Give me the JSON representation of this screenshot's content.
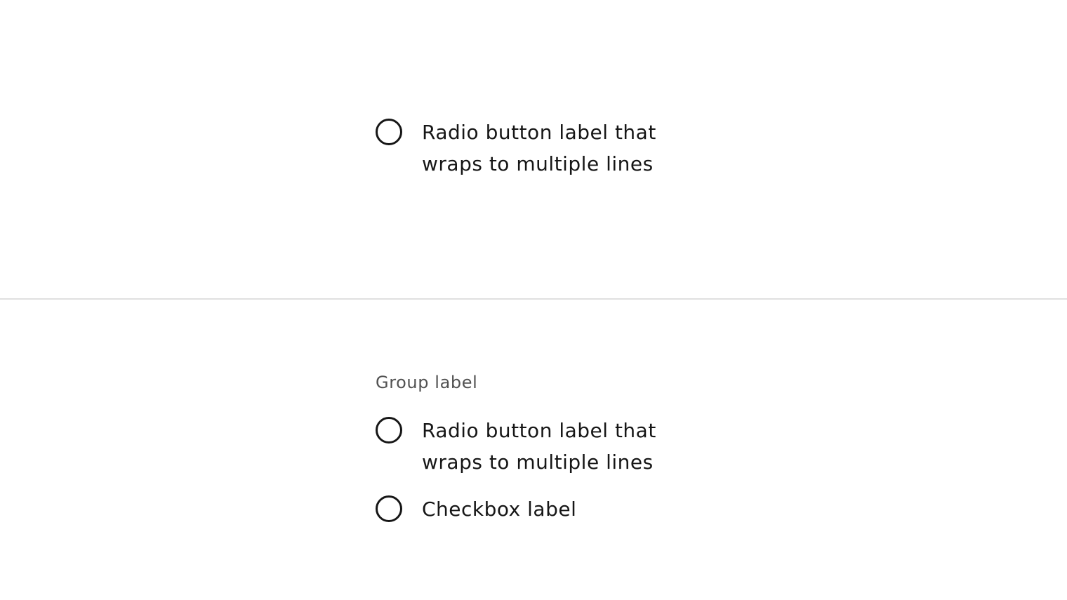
{
  "top_section": {
    "radio": {
      "label_line1": "Radio button label that",
      "label_line2": "wraps to multiple lines"
    }
  },
  "bottom_section": {
    "group_label": "Group label",
    "options": [
      {
        "label_line1": "Radio button label that",
        "label_line2": "wraps to multiple lines"
      },
      {
        "label": "Checkbox label"
      }
    ]
  },
  "colors": {
    "text": "#161616",
    "group_label": "#525252",
    "divider": "#e0e0e0",
    "background": "#ffffff"
  },
  "icons": [
    "radio-unselected-icon"
  ]
}
